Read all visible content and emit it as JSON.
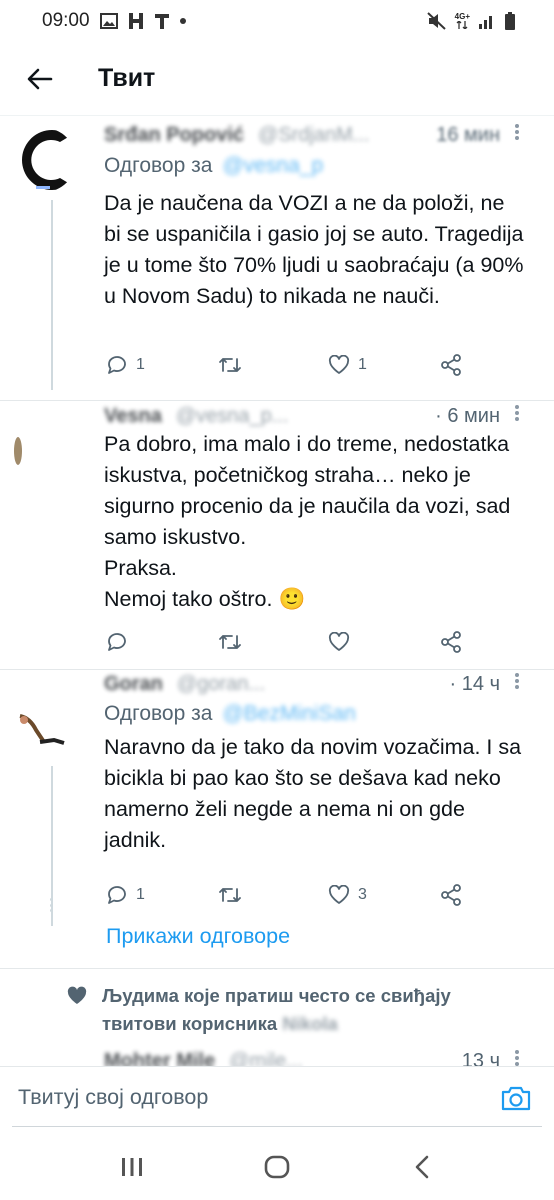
{
  "status_bar": {
    "time": "09:00",
    "network": "4G+"
  },
  "header": {
    "title": "Твит"
  },
  "tweets": [
    {
      "author_name": "Srđan Popović",
      "author_handle": "@SrdjanM...",
      "time": "16 мин",
      "reply_label": "Одговор за",
      "reply_handle": "@vesna_p",
      "text": "Da je naučena da VOZI a ne da položi, ne bi se uspaničila i gasio joj se auto. Tragedija je u tome što 70% ljudi u saobraćaju (a 90% u Novom Sadu) to nikada ne nauči.",
      "replies": "1",
      "retweets": "",
      "likes": "1"
    },
    {
      "author_name": "Vesna",
      "author_handle": "@vesna_p...",
      "time": "6 мин",
      "text": "Pa dobro, ima malo i do treme, nedostatka iskustva, početničkog straha… neko je sigurno procenio da je naučila da vozi, sad samo iskustvo.\nPraksa.\nNemoj tako oštro. 🙂",
      "replies": "",
      "retweets": "",
      "likes": ""
    },
    {
      "author_name": "Goran",
      "author_handle": "@goran...",
      "time": "14 ч",
      "reply_label": "Одговор за",
      "reply_handle": "@BezMiniSan",
      "text": "Naravno da je tako da novim vozačima. I sa bicikla bi pao kao što se dešava kad neko namerno želi negde a nema ni on gde jadnik.",
      "replies": "1",
      "retweets": "",
      "likes": "3",
      "show_replies": "Прикажи одговоре"
    }
  ],
  "social_context": {
    "text": "Људима које пратиш често се свиђају твитови корисника",
    "blurred_name": "Nikola"
  },
  "partial_tweet": {
    "author_name": "Mohter Mile",
    "author_handle": "@mile...",
    "time": "13 ч"
  },
  "reply_bar": {
    "placeholder": "Твитуј свој одговор"
  },
  "colors": {
    "accent": "#1d9bf0",
    "secondary_text": "#536471",
    "primary_text": "#0f1419",
    "divider": "#e4e8ea"
  }
}
